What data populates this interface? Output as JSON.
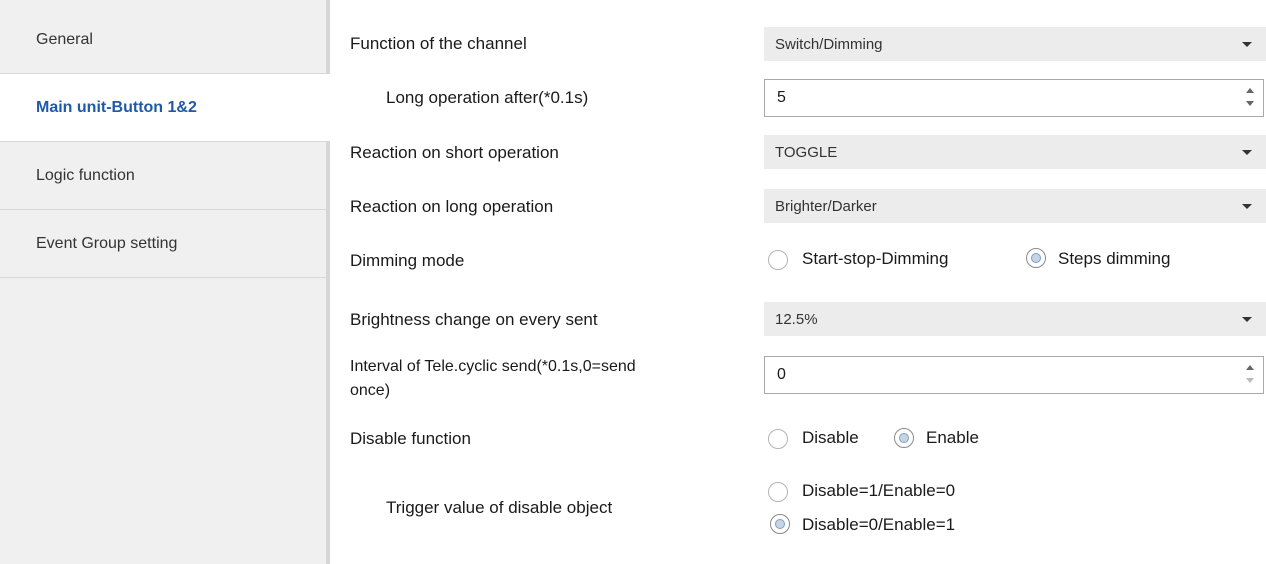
{
  "sidebar": {
    "items": [
      {
        "label": "General"
      },
      {
        "label": "Main unit-Button 1&2"
      },
      {
        "label": "Logic function"
      },
      {
        "label": "Event Group setting"
      }
    ],
    "active_index": 1
  },
  "params": {
    "function_channel": {
      "label": "Function of the channel",
      "value": "Switch/Dimming"
    },
    "long_operation": {
      "label": "Long operation after(*0.1s)",
      "value": "5"
    },
    "short_reaction": {
      "label": "Reaction on short operation",
      "value": "TOGGLE"
    },
    "long_reaction": {
      "label": "Reaction on long operation",
      "value": "Brighter/Darker"
    },
    "dimming_mode": {
      "label": "Dimming mode",
      "options": [
        "Start-stop-Dimming",
        "Steps dimming"
      ],
      "selected": "Steps dimming"
    },
    "brightness_change": {
      "label": "Brightness change on every sent",
      "value": "12.5%"
    },
    "interval": {
      "label_line1": "Interval of Tele.cyclic send(*0.1s,0=send",
      "label_line2": "once)",
      "value": "0"
    },
    "disable_function": {
      "label": "Disable function",
      "options": [
        "Disable",
        "Enable"
      ],
      "selected": "Enable"
    },
    "trigger_value": {
      "label": "Trigger value of disable object",
      "options": [
        "Disable=1/Enable=0",
        "Disable=0/Enable=1"
      ],
      "selected": "Disable=0/Enable=1"
    }
  },
  "colors": {
    "active_nav_text": "#1e5aa8",
    "sidebar_bg": "#f0f0f0",
    "select_bg": "#ececec"
  }
}
